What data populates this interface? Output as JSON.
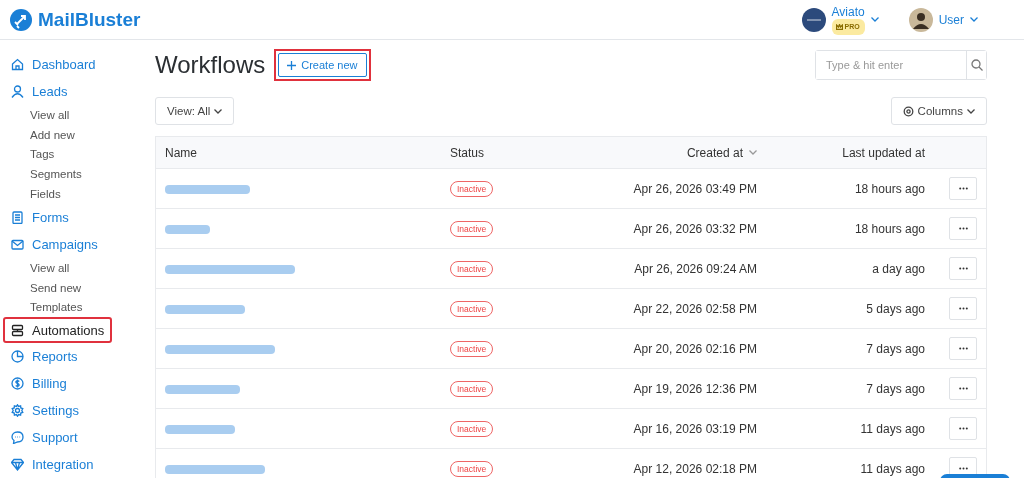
{
  "brand": {
    "name": "MailBluster"
  },
  "account": {
    "name": "Aviato",
    "badge": "PRO"
  },
  "user": {
    "name": "User"
  },
  "sidebar": {
    "items": [
      {
        "label": "Dashboard",
        "selected": false,
        "highlighted": false
      },
      {
        "label": "Leads",
        "selected": false,
        "highlighted": false,
        "children": [
          {
            "label": "View all"
          },
          {
            "label": "Add new"
          },
          {
            "label": "Tags"
          },
          {
            "label": "Segments"
          },
          {
            "label": "Fields"
          }
        ]
      },
      {
        "label": "Forms",
        "selected": false,
        "highlighted": false
      },
      {
        "label": "Campaigns",
        "selected": false,
        "highlighted": false,
        "children": [
          {
            "label": "View all"
          },
          {
            "label": "Send new"
          },
          {
            "label": "Templates"
          }
        ]
      },
      {
        "label": "Automations",
        "selected": true,
        "highlighted": true
      },
      {
        "label": "Reports",
        "selected": false,
        "highlighted": false
      },
      {
        "label": "Billing",
        "selected": false,
        "highlighted": false
      },
      {
        "label": "Settings",
        "selected": false,
        "highlighted": false
      },
      {
        "label": "Support",
        "selected": false,
        "highlighted": false
      },
      {
        "label": "Integration",
        "selected": false,
        "highlighted": false
      }
    ]
  },
  "page": {
    "title": "Workflows",
    "create_button": {
      "label": "Create new",
      "highlighted": true
    },
    "search": {
      "placeholder": "Type & hit enter"
    },
    "view_filter": "View: All",
    "columns_button": "Columns"
  },
  "table": {
    "columns": [
      {
        "label": "Name",
        "sorted": false
      },
      {
        "label": "Status",
        "sorted": false
      },
      {
        "label": "Created at",
        "sorted": true
      },
      {
        "label": "Last updated at",
        "sorted": false
      }
    ],
    "rows": [
      {
        "redacted": true,
        "status": "Inactive",
        "created": "Apr 26, 2026 03:49 PM",
        "updated": "18 hours ago"
      },
      {
        "redacted": true,
        "status": "Inactive",
        "created": "Apr 26, 2026 03:32 PM",
        "updated": "18 hours ago"
      },
      {
        "redacted": true,
        "status": "Inactive",
        "created": "Apr 26, 2026 09:24 AM",
        "updated": "a day ago"
      },
      {
        "redacted": true,
        "status": "Inactive",
        "created": "Apr 22, 2026 02:58 PM",
        "updated": "5 days ago"
      },
      {
        "redacted": true,
        "status": "Inactive",
        "created": "Apr 20, 2026 02:16 PM",
        "updated": "7 days ago"
      },
      {
        "redacted": true,
        "status": "Inactive",
        "created": "Apr 19, 2026 12:36 PM",
        "updated": "7 days ago"
      },
      {
        "redacted": true,
        "status": "Inactive",
        "created": "Apr 16, 2026 03:19 PM",
        "updated": "11 days ago"
      },
      {
        "redacted": true,
        "status": "Inactive",
        "created": "Apr 12, 2026 02:18 PM",
        "updated": "11 days ago"
      }
    ]
  }
}
